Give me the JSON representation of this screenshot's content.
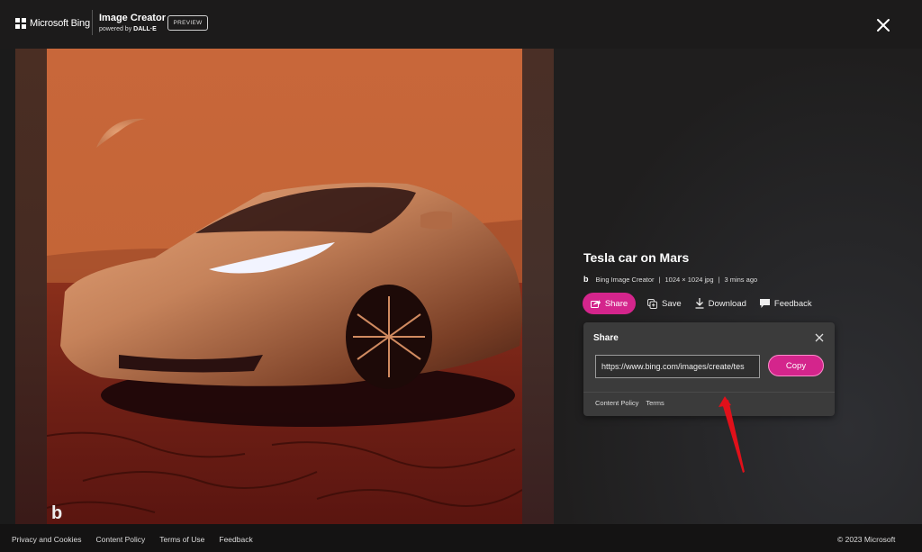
{
  "header": {
    "brand": "Microsoft Bing",
    "product_title": "Image Creator",
    "powered_by_prefix": "powered by",
    "powered_by_name": "DALL·E",
    "badge": "PREVIEW",
    "close_icon": "close-icon"
  },
  "image": {
    "alt": "Tesla car on Mars",
    "watermark": "b"
  },
  "detail": {
    "title": "Tesla car on Mars",
    "source": "Bing Image Creator",
    "separator": "|",
    "dimensions": "1024 × 1024 jpg",
    "age": "3 mins ago",
    "actions": {
      "share": "Share",
      "save": "Save",
      "download": "Download",
      "feedback": "Feedback"
    }
  },
  "share_panel": {
    "title": "Share",
    "url": "https://www.bing.com/images/create/tes",
    "copy": "Copy",
    "links": [
      "Content Policy",
      "Terms"
    ]
  },
  "footer": {
    "links": [
      "Privacy and Cookies",
      "Content Policy",
      "Terms of Use",
      "Feedback"
    ],
    "copyright": "© 2023 Microsoft"
  },
  "colors": {
    "accent": "#d4258c",
    "background": "#1c1b1b",
    "panel": "#3b3b3b",
    "annotation_arrow": "#e0101a"
  }
}
